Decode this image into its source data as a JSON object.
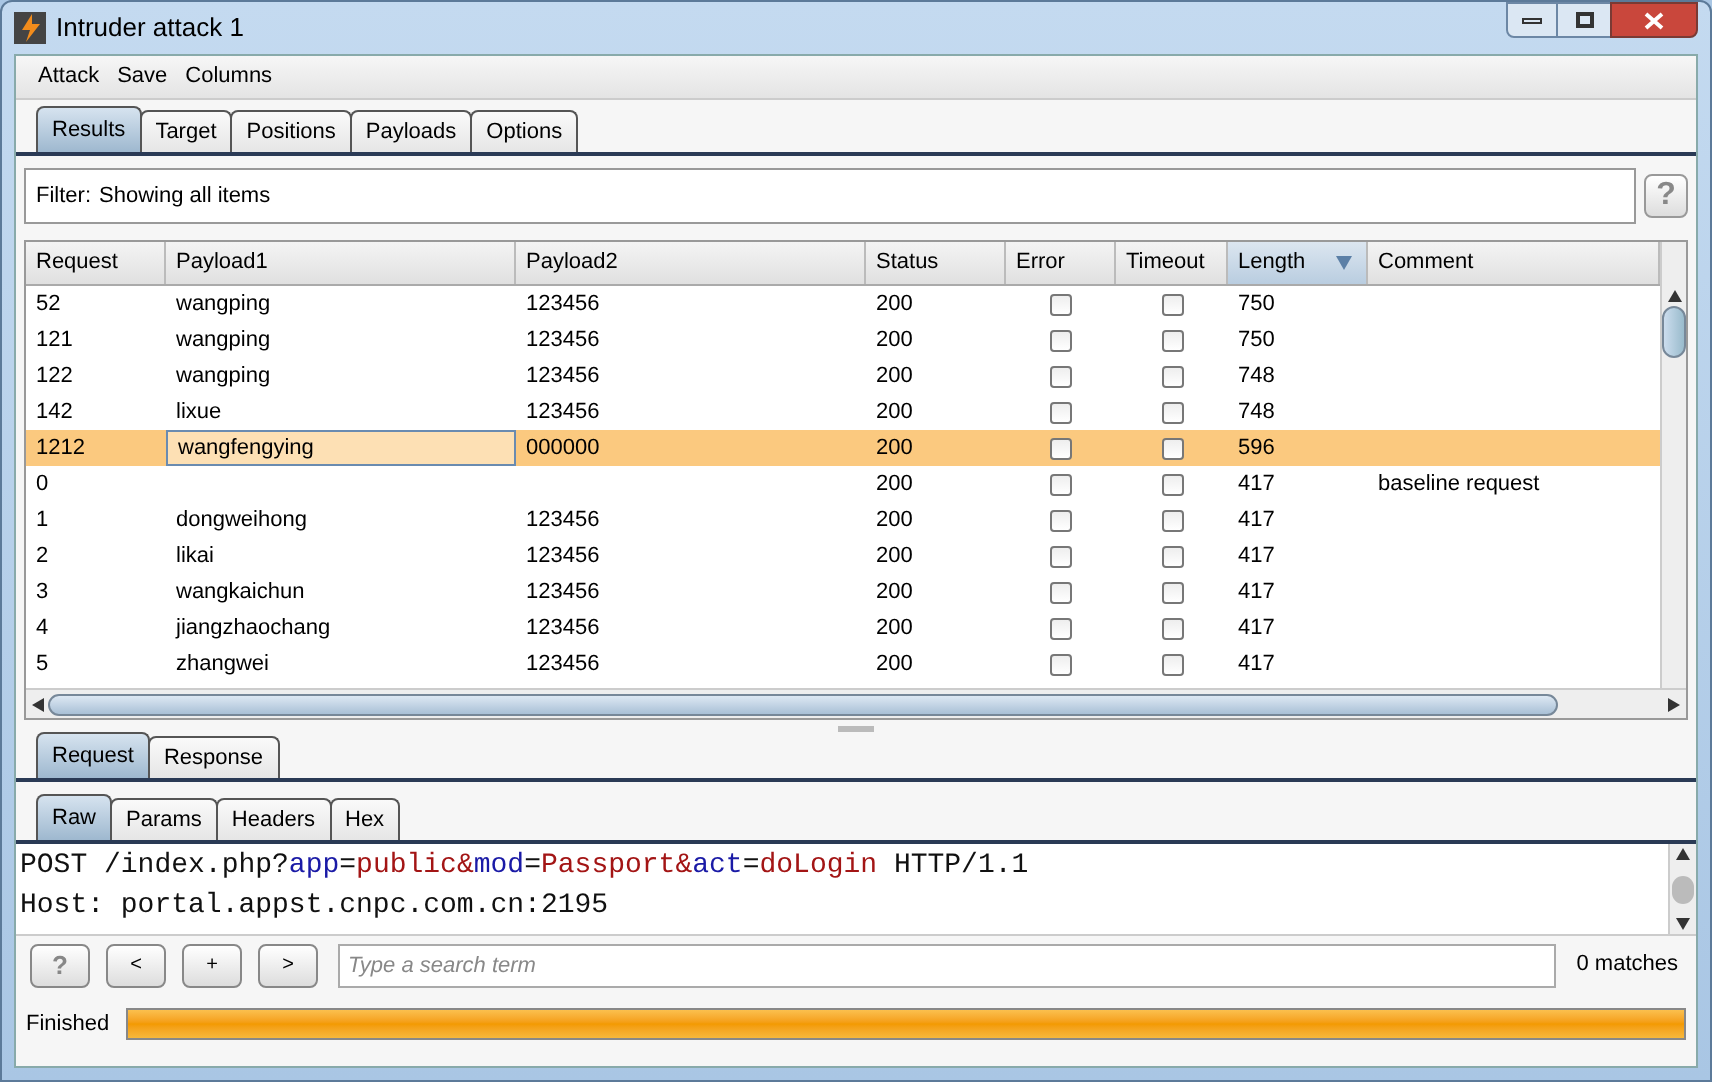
{
  "window": {
    "title": "Intruder attack 1"
  },
  "menu": [
    "Attack",
    "Save",
    "Columns"
  ],
  "tabs": [
    {
      "label": "Results",
      "selected": true
    },
    {
      "label": "Target",
      "selected": false
    },
    {
      "label": "Positions",
      "selected": false
    },
    {
      "label": "Payloads",
      "selected": false
    },
    {
      "label": "Options",
      "selected": false
    }
  ],
  "filter": {
    "label": "Filter:",
    "value": "Showing all items",
    "help": "?"
  },
  "table": {
    "columns": [
      {
        "label": "Request",
        "sorted": false
      },
      {
        "label": "Payload1",
        "sorted": false
      },
      {
        "label": "Payload2",
        "sorted": false
      },
      {
        "label": "Status",
        "sorted": false
      },
      {
        "label": "Error",
        "sorted": false
      },
      {
        "label": "Timeout",
        "sorted": false
      },
      {
        "label": "Length",
        "sorted": true
      },
      {
        "label": "Comment",
        "sorted": false
      }
    ],
    "rows": [
      {
        "request": "52",
        "payload1": "wangping",
        "payload2": "123456",
        "status": "200",
        "error": false,
        "timeout": false,
        "length": "750",
        "comment": "",
        "selected": false
      },
      {
        "request": "121",
        "payload1": "wangping",
        "payload2": "123456",
        "status": "200",
        "error": false,
        "timeout": false,
        "length": "750",
        "comment": "",
        "selected": false
      },
      {
        "request": "122",
        "payload1": "wangping",
        "payload2": "123456",
        "status": "200",
        "error": false,
        "timeout": false,
        "length": "748",
        "comment": "",
        "selected": false
      },
      {
        "request": "142",
        "payload1": "lixue",
        "payload2": "123456",
        "status": "200",
        "error": false,
        "timeout": false,
        "length": "748",
        "comment": "",
        "selected": false
      },
      {
        "request": "1212",
        "payload1": "wangfengying",
        "payload2": "000000",
        "status": "200",
        "error": false,
        "timeout": false,
        "length": "596",
        "comment": "",
        "selected": true
      },
      {
        "request": "0",
        "payload1": "",
        "payload2": "",
        "status": "200",
        "error": false,
        "timeout": false,
        "length": "417",
        "comment": "baseline request",
        "selected": false
      },
      {
        "request": "1",
        "payload1": "dongweihong",
        "payload2": "123456",
        "status": "200",
        "error": false,
        "timeout": false,
        "length": "417",
        "comment": "",
        "selected": false
      },
      {
        "request": "2",
        "payload1": "likai",
        "payload2": "123456",
        "status": "200",
        "error": false,
        "timeout": false,
        "length": "417",
        "comment": "",
        "selected": false
      },
      {
        "request": "3",
        "payload1": "wangkaichun",
        "payload2": "123456",
        "status": "200",
        "error": false,
        "timeout": false,
        "length": "417",
        "comment": "",
        "selected": false
      },
      {
        "request": "4",
        "payload1": "jiangzhaochang",
        "payload2": "123456",
        "status": "200",
        "error": false,
        "timeout": false,
        "length": "417",
        "comment": "",
        "selected": false
      },
      {
        "request": "5",
        "payload1": "zhangwei",
        "payload2": "123456",
        "status": "200",
        "error": false,
        "timeout": false,
        "length": "417",
        "comment": "",
        "selected": false
      }
    ]
  },
  "message_tabs": [
    {
      "label": "Request",
      "selected": true
    },
    {
      "label": "Response",
      "selected": false
    }
  ],
  "view_tabs": [
    {
      "label": "Raw",
      "selected": true
    },
    {
      "label": "Params",
      "selected": false
    },
    {
      "label": "Headers",
      "selected": false
    },
    {
      "label": "Hex",
      "selected": false
    }
  ],
  "editor": {
    "lines": [
      [
        {
          "text": "POST /index.php?",
          "kind": "plain"
        },
        {
          "text": "app",
          "kind": "name"
        },
        {
          "text": "=",
          "kind": "plain"
        },
        {
          "text": "public&",
          "kind": "value"
        },
        {
          "text": "mod",
          "kind": "name"
        },
        {
          "text": "=",
          "kind": "plain"
        },
        {
          "text": "Passport&",
          "kind": "value"
        },
        {
          "text": "act",
          "kind": "name"
        },
        {
          "text": "=",
          "kind": "plain"
        },
        {
          "text": "doLogin",
          "kind": "value"
        },
        {
          "text": " HTTP/1.1",
          "kind": "plain"
        }
      ],
      [
        {
          "text": "Host: portal.appst.cnpc.com.cn:2195",
          "kind": "plain"
        }
      ]
    ]
  },
  "search": {
    "buttons": [
      "?",
      "<",
      "+",
      ">"
    ],
    "placeholder": "Type a search term",
    "matches": "0 matches"
  },
  "status_bar": {
    "label": "Finished",
    "level": 1
  }
}
